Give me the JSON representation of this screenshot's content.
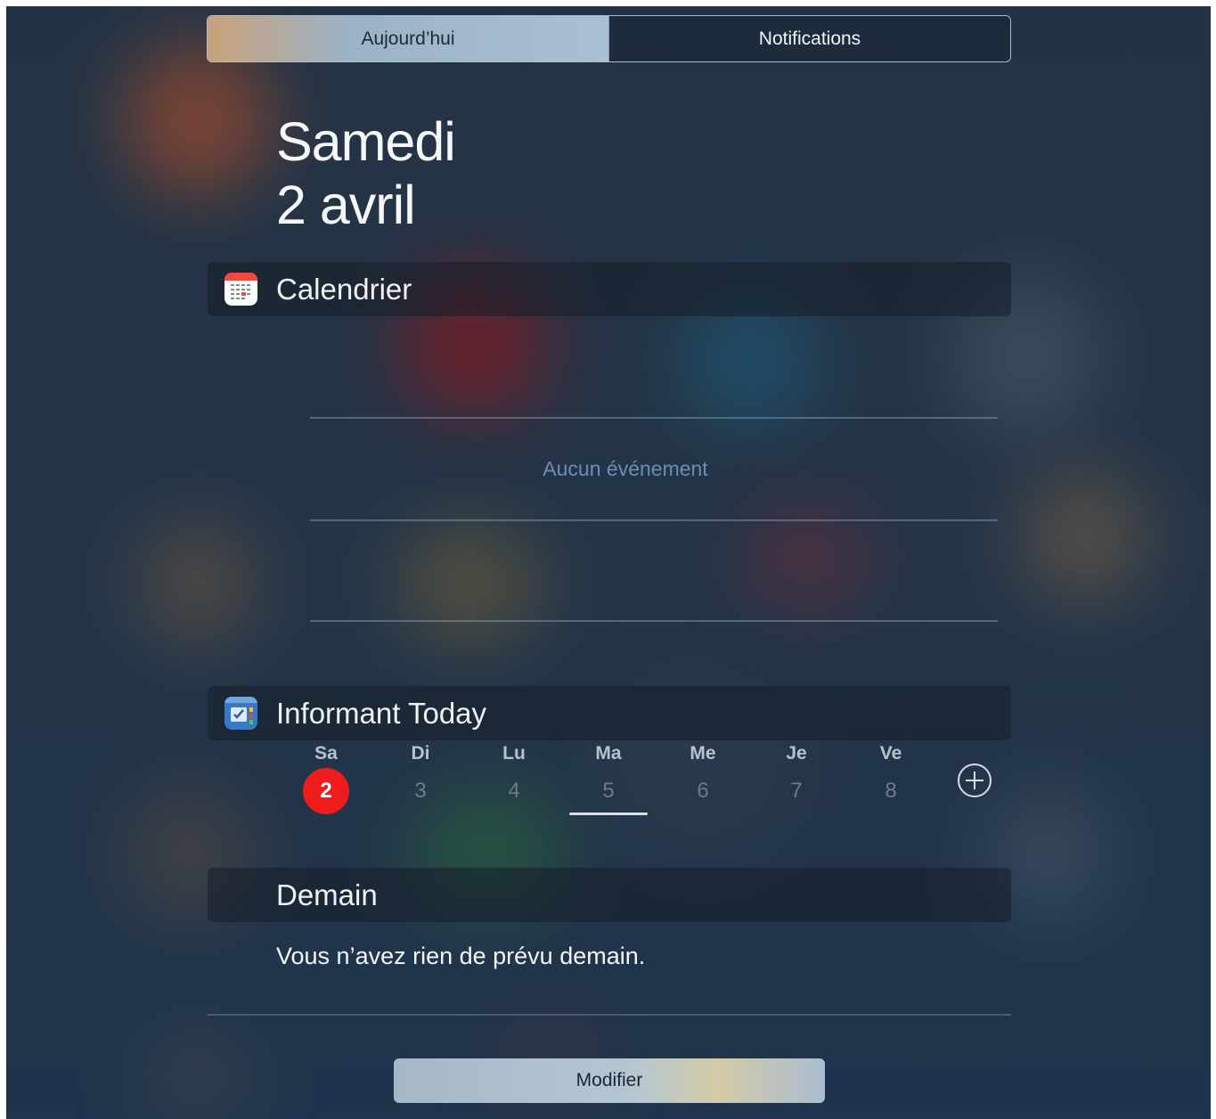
{
  "tabs": {
    "today": "Aujourd’hui",
    "notifications": "Notifications"
  },
  "date": {
    "weekday": "Samedi",
    "day_month": "2 avril"
  },
  "calendar_widget": {
    "title": "Calendrier",
    "icon": "calendar-app-icon",
    "empty_text": "Aucun événement"
  },
  "informant_widget": {
    "title": "Informant Today",
    "icon": "informant-app-icon",
    "days": [
      {
        "name": "Sa",
        "number": "2"
      },
      {
        "name": "Di",
        "number": "3"
      },
      {
        "name": "Lu",
        "number": "4"
      },
      {
        "name": "Ma",
        "number": "5"
      },
      {
        "name": "Me",
        "number": "6"
      },
      {
        "name": "Je",
        "number": "7"
      },
      {
        "name": "Ve",
        "number": "8"
      }
    ],
    "add_icon": "plus-circle-icon"
  },
  "tomorrow": {
    "title": "Demain",
    "message": "Vous n’avez rien de prévu demain."
  },
  "footer": {
    "modify_label": "Modifier"
  },
  "colors": {
    "today_badge": "#ee1c1c",
    "background": "#26374a"
  }
}
